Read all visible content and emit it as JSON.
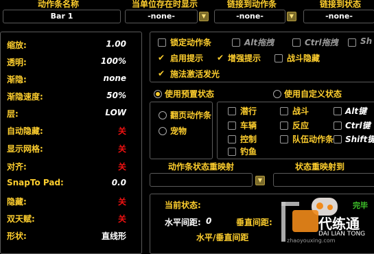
{
  "header": {
    "bar_name_label": "动作条名称",
    "show_on_unit_label": "当单位存在时显示",
    "link_bar_label": "链接到动作条",
    "link_state_label": "链接到状态"
  },
  "combos": {
    "bar_name": "Bar 1",
    "show_on_unit": "-none-",
    "link_bar": "-none-",
    "link_state": "-none-"
  },
  "settings": [
    {
      "label": "缩放:",
      "value": "1.00",
      "style": "italic"
    },
    {
      "label": "透明:",
      "value": "100%",
      "style": "italic"
    },
    {
      "label": "渐隐:",
      "value": "none",
      "style": "italic"
    },
    {
      "label": "渐隐速度:",
      "value": "50%",
      "style": "italic"
    },
    {
      "label": "层:",
      "value": "LOW",
      "style": "italic"
    },
    {
      "label": "自动隐藏:",
      "value": "关",
      "style": "red"
    },
    {
      "label": "显示网格:",
      "value": "关",
      "style": "red"
    },
    {
      "label": "对齐:",
      "value": "关",
      "style": "red"
    },
    {
      "label": "SnapTo Pad:",
      "value": "0.0",
      "style": "italic"
    },
    {
      "label": "隐藏:",
      "value": "关",
      "style": "red"
    },
    {
      "label": "双天赋:",
      "value": "关",
      "style": "red"
    },
    {
      "label": "形状:",
      "value": "直线形",
      "style": "plain"
    }
  ],
  "options": {
    "lock_bar": "锁定动作条",
    "alt_drag": "Alt拖拽",
    "ctrl_drag": "Ctrl拖拽",
    "shift_drag": "Sh",
    "enable_tooltip": "启用提示",
    "enhanced_tooltip": "增强提示",
    "combat_hide": "战斗隐藏",
    "cast_glow": "施法激活发光"
  },
  "states": {
    "preset_label": "使用预置状态",
    "custom_label": "使用自定义状态",
    "paging": "翻页动作条",
    "pet": "宠物",
    "stealth": "潜行",
    "vehicle": "车辆",
    "control": "控制",
    "fishing": "钓鱼",
    "combat": "战斗",
    "reaction": "反应",
    "party_bar": "队伍动作条",
    "alt_key": "Alt键",
    "ctrl_key": "Ctrl键",
    "shift_key": "Shift键"
  },
  "remap": {
    "bar_state_remap": "动作条状态重映射",
    "state_remap_to": "状态重映射到"
  },
  "current": {
    "current_state": "当前状态:",
    "hpad_label": "水平间距:",
    "hpad_value": "0",
    "vpad_label": "垂直间距:",
    "hv_label": "水平/垂直间距",
    "green_text": "完毕"
  },
  "watermark": {
    "cn": "代练通",
    "en": "DAI LIAN TONG",
    "url": "zhaoyouxing.com"
  },
  "colors": {
    "accent": "#ffcf2e",
    "off_red": "#e11",
    "green": "#3fc52a"
  }
}
